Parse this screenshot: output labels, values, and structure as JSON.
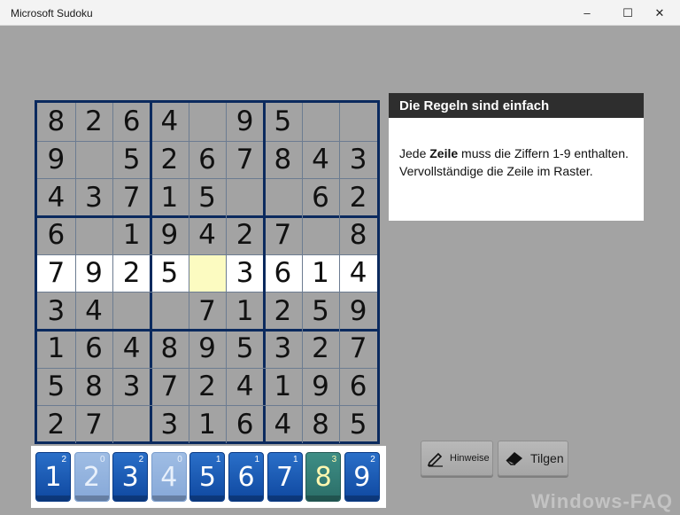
{
  "window": {
    "title": "Microsoft Sudoku"
  },
  "controls": {
    "minimize": "–",
    "maximize": "☐",
    "close": "✕"
  },
  "board": {
    "cells": [
      [
        "8",
        "2",
        "6",
        "4",
        "",
        "9",
        "5",
        "",
        ""
      ],
      [
        "9",
        "",
        "5",
        "2",
        "6",
        "7",
        "8",
        "4",
        "3"
      ],
      [
        "4",
        "3",
        "7",
        "1",
        "5",
        "",
        "",
        "6",
        "2"
      ],
      [
        "6",
        "",
        "1",
        "9",
        "4",
        "2",
        "7",
        "",
        "8"
      ],
      [
        "7",
        "9",
        "2",
        "5",
        "",
        "3",
        "6",
        "1",
        "4"
      ],
      [
        "3",
        "4",
        "",
        "",
        "7",
        "1",
        "2",
        "5",
        "9"
      ],
      [
        "1",
        "6",
        "4",
        "8",
        "9",
        "5",
        "3",
        "2",
        "7"
      ],
      [
        "5",
        "8",
        "3",
        "7",
        "2",
        "4",
        "1",
        "9",
        "6"
      ],
      [
        "2",
        "7",
        "",
        "3",
        "1",
        "6",
        "4",
        "8",
        "5"
      ]
    ],
    "highlighted_row": 4,
    "selected_col": 4
  },
  "rules": {
    "title": "Die Regeln sind einfach",
    "text_prefix": "Jede ",
    "text_bold": "Zeile",
    "text_rest": " muss die Ziffern 1-9 enthalten. Vervollständige die Zeile im Raster."
  },
  "palette": [
    {
      "digit": "1",
      "count": "2",
      "state": "normal"
    },
    {
      "digit": "2",
      "count": "0",
      "state": "faded"
    },
    {
      "digit": "3",
      "count": "2",
      "state": "normal"
    },
    {
      "digit": "4",
      "count": "0",
      "state": "faded"
    },
    {
      "digit": "5",
      "count": "1",
      "state": "normal"
    },
    {
      "digit": "6",
      "count": "1",
      "state": "normal"
    },
    {
      "digit": "7",
      "count": "1",
      "state": "normal"
    },
    {
      "digit": "8",
      "count": "3",
      "state": "selected"
    },
    {
      "digit": "9",
      "count": "2",
      "state": "normal"
    }
  ],
  "tools": {
    "hint_label": "Hinweise",
    "erase_label": "Tilgen"
  },
  "watermark": "Windows-FAQ",
  "colors": {
    "board_border": "#0b2a5e",
    "tile_blue": "#1a5bb5",
    "selected_cell": "#fcfbc1",
    "rules_header": "#2e2e2e"
  }
}
